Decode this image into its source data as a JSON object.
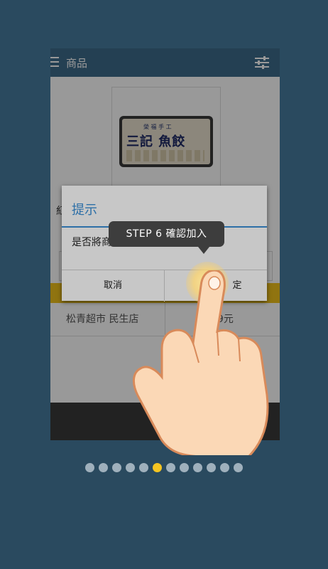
{
  "app": {
    "title": "商品",
    "menu_icon": "hamburger-menu-icon",
    "filter_icon": "filter-sliders-icon"
  },
  "product": {
    "package_top_text": "榮 福 手 工",
    "package_brand": "三記 魚餃",
    "left_text_fragment": "紅"
  },
  "store_row": {
    "store_name": "松青超市 民生店",
    "price": "89元"
  },
  "dialog": {
    "title": "提示",
    "message": "是否將商品加入預購清單",
    "cancel_label": "取消",
    "ok_label": "定"
  },
  "tooltip": {
    "text": "STEP 6  確認加入"
  },
  "pager": {
    "total": 12,
    "active_index": 5
  },
  "colors": {
    "background": "#2a4a5f",
    "appbar": "#3c6b8b",
    "accent": "#3a8fd6",
    "highlight": "#f0c21c",
    "active_dot": "#f5c522",
    "dot": "#9fb0bc"
  }
}
